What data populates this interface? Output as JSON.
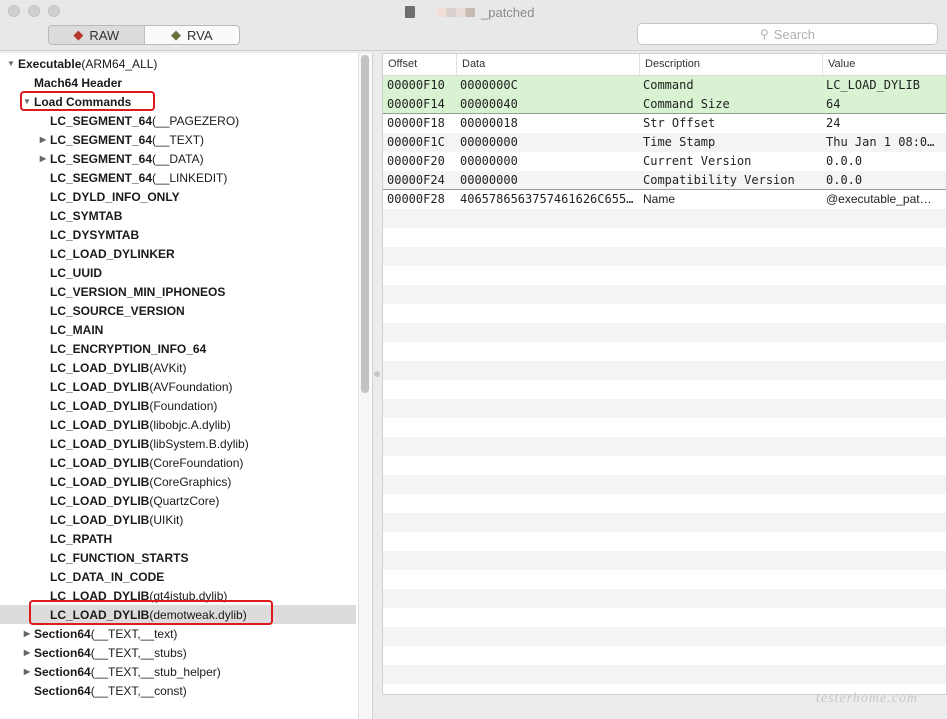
{
  "window": {
    "title": "_patched"
  },
  "toolbar": {
    "raw_label": "RAW",
    "rva_label": "RVA",
    "search_placeholder": "Search"
  },
  "tree": [
    {
      "label": "Executable",
      "suffix": " (ARM64_ALL)",
      "indent": 0,
      "tri": "open"
    },
    {
      "label": "Mach64 Header",
      "suffix": "",
      "indent": 1,
      "tri": ""
    },
    {
      "label": "Load Commands",
      "suffix": "",
      "indent": 1,
      "tri": "open"
    },
    {
      "label": "LC_SEGMENT_64",
      "suffix": " (__PAGEZERO)",
      "indent": 2,
      "tri": ""
    },
    {
      "label": "LC_SEGMENT_64",
      "suffix": " (__TEXT)",
      "indent": 2,
      "tri": "closed"
    },
    {
      "label": "LC_SEGMENT_64",
      "suffix": " (__DATA)",
      "indent": 2,
      "tri": "closed"
    },
    {
      "label": "LC_SEGMENT_64",
      "suffix": " (__LINKEDIT)",
      "indent": 2,
      "tri": ""
    },
    {
      "label": "LC_DYLD_INFO_ONLY",
      "suffix": "",
      "indent": 2,
      "tri": ""
    },
    {
      "label": "LC_SYMTAB",
      "suffix": "",
      "indent": 2,
      "tri": ""
    },
    {
      "label": "LC_DYSYMTAB",
      "suffix": "",
      "indent": 2,
      "tri": ""
    },
    {
      "label": "LC_LOAD_DYLINKER",
      "suffix": "",
      "indent": 2,
      "tri": ""
    },
    {
      "label": "LC_UUID",
      "suffix": "",
      "indent": 2,
      "tri": ""
    },
    {
      "label": "LC_VERSION_MIN_IPHONEOS",
      "suffix": "",
      "indent": 2,
      "tri": ""
    },
    {
      "label": "LC_SOURCE_VERSION",
      "suffix": "",
      "indent": 2,
      "tri": ""
    },
    {
      "label": "LC_MAIN",
      "suffix": "",
      "indent": 2,
      "tri": ""
    },
    {
      "label": "LC_ENCRYPTION_INFO_64",
      "suffix": "",
      "indent": 2,
      "tri": ""
    },
    {
      "label": "LC_LOAD_DYLIB",
      "suffix": " (AVKit)",
      "indent": 2,
      "tri": ""
    },
    {
      "label": "LC_LOAD_DYLIB",
      "suffix": " (AVFoundation)",
      "indent": 2,
      "tri": ""
    },
    {
      "label": "LC_LOAD_DYLIB",
      "suffix": " (Foundation)",
      "indent": 2,
      "tri": ""
    },
    {
      "label": "LC_LOAD_DYLIB",
      "suffix": " (libobjc.A.dylib)",
      "indent": 2,
      "tri": ""
    },
    {
      "label": "LC_LOAD_DYLIB",
      "suffix": " (libSystem.B.dylib)",
      "indent": 2,
      "tri": ""
    },
    {
      "label": "LC_LOAD_DYLIB",
      "suffix": " (CoreFoundation)",
      "indent": 2,
      "tri": ""
    },
    {
      "label": "LC_LOAD_DYLIB",
      "suffix": " (CoreGraphics)",
      "indent": 2,
      "tri": ""
    },
    {
      "label": "LC_LOAD_DYLIB",
      "suffix": " (QuartzCore)",
      "indent": 2,
      "tri": ""
    },
    {
      "label": "LC_LOAD_DYLIB",
      "suffix": " (UIKit)",
      "indent": 2,
      "tri": ""
    },
    {
      "label": "LC_RPATH",
      "suffix": "",
      "indent": 2,
      "tri": ""
    },
    {
      "label": "LC_FUNCTION_STARTS",
      "suffix": "",
      "indent": 2,
      "tri": ""
    },
    {
      "label": "LC_DATA_IN_CODE",
      "suffix": "",
      "indent": 2,
      "tri": ""
    },
    {
      "label": "LC_LOAD_DYLIB",
      "suffix": " (gt4istub.dylib)",
      "indent": 2,
      "tri": ""
    },
    {
      "label": "LC_LOAD_DYLIB",
      "suffix": " (demotweak.dylib)",
      "indent": 2,
      "tri": "",
      "selected": true
    },
    {
      "label": "Section64",
      "suffix": " (__TEXT,__text)",
      "indent": 1,
      "tri": "closed"
    },
    {
      "label": "Section64",
      "suffix": " (__TEXT,__stubs)",
      "indent": 1,
      "tri": "closed"
    },
    {
      "label": "Section64",
      "suffix": " (__TEXT,__stub_helper)",
      "indent": 1,
      "tri": "closed"
    },
    {
      "label": "Section64",
      "suffix": " (__TEXT,__const)",
      "indent": 1,
      "tri": ""
    }
  ],
  "table": {
    "headers": [
      "Offset",
      "Data",
      "Description",
      "Value"
    ],
    "rows": [
      {
        "offset": "00000F10",
        "data": "0000000C",
        "description": "Command",
        "value": "LC_LOAD_DYLIB",
        "hl": true
      },
      {
        "offset": "00000F14",
        "data": "00000040",
        "description": "Command Size",
        "value": "64",
        "hl": true,
        "sep": true
      },
      {
        "offset": "00000F18",
        "data": "00000018",
        "description": "Str Offset",
        "value": "24"
      },
      {
        "offset": "00000F1C",
        "data": "00000000",
        "description": "Time Stamp",
        "value": "Thu Jan  1 08:0…"
      },
      {
        "offset": "00000F20",
        "data": "00000000",
        "description": "Current Version",
        "value": "0.0.0"
      },
      {
        "offset": "00000F24",
        "data": "00000000",
        "description": "Compatibility Version",
        "value": "0.0.0",
        "sep": true
      },
      {
        "offset": "00000F28",
        "data": "406578656375746162​6C655…",
        "description": "Name",
        "value": "@executable_pat…",
        "name": true
      }
    ]
  },
  "watermark": "testerhome.com"
}
